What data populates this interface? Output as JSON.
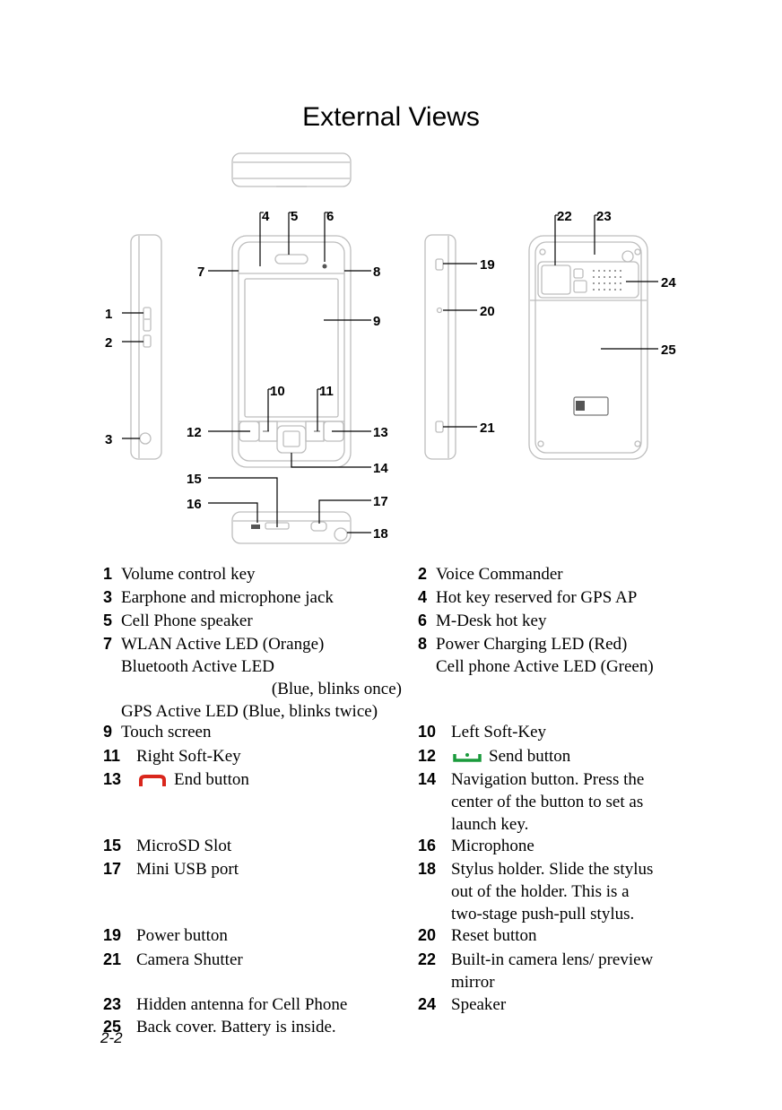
{
  "page": {
    "title": "External Views",
    "page_number": "2-2"
  },
  "colors": {
    "end_button_icon": "#d9261c",
    "send_button_icon": "#1a9a3c",
    "outline": "#bdbdbd"
  },
  "diagram": {
    "callouts": [
      "1",
      "2",
      "3",
      "4",
      "5",
      "6",
      "7",
      "8",
      "9",
      "10",
      "11",
      "12",
      "13",
      "14",
      "15",
      "16",
      "17",
      "18",
      "19",
      "20",
      "21",
      "22",
      "23",
      "24",
      "25"
    ]
  },
  "items": [
    {
      "num": "1",
      "lines": [
        "Volume control key"
      ]
    },
    {
      "num": "2",
      "lines": [
        "Voice Commander"
      ]
    },
    {
      "num": "3",
      "lines": [
        "Earphone and microphone jack"
      ]
    },
    {
      "num": "4",
      "lines": [
        "Hot key reserved for GPS AP"
      ]
    },
    {
      "num": "5",
      "lines": [
        "Cell Phone speaker"
      ]
    },
    {
      "num": "6",
      "lines": [
        "M-Desk hot key"
      ]
    },
    {
      "num": "7",
      "lines": [
        "WLAN Active LED (Orange)",
        "Bluetooth Active LED",
        "(Blue, blinks once)",
        "GPS Active LED (Blue, blinks twice)"
      ]
    },
    {
      "num": "8",
      "lines": [
        "Power Charging LED (Red)",
        "Cell phone Active LED (Green)"
      ]
    },
    {
      "num": "9",
      "lines": [
        "Touch screen"
      ]
    },
    {
      "num": "10",
      "lines": [
        "Left Soft-Key"
      ]
    },
    {
      "num": "11",
      "lines": [
        "Right Soft-Key"
      ]
    },
    {
      "num": "12",
      "icon": "send-button-icon",
      "lines": [
        "Send button"
      ]
    },
    {
      "num": "13",
      "icon": "end-button-icon",
      "lines": [
        "End button"
      ]
    },
    {
      "num": "14",
      "lines": [
        "Navigation button. Press the",
        "center of the button to set as",
        "launch key."
      ]
    },
    {
      "num": "15",
      "lines": [
        "MicroSD Slot"
      ]
    },
    {
      "num": "16",
      "lines": [
        "Microphone"
      ]
    },
    {
      "num": "17",
      "lines": [
        "Mini USB port"
      ]
    },
    {
      "num": "18",
      "lines": [
        "Stylus holder. Slide the stylus",
        "out of the holder. This is a",
        "two-stage push-pull stylus."
      ]
    },
    {
      "num": "19",
      "lines": [
        "Power button"
      ]
    },
    {
      "num": "20",
      "lines": [
        "Reset button"
      ]
    },
    {
      "num": "21",
      "lines": [
        "Camera Shutter"
      ]
    },
    {
      "num": "22",
      "lines": [
        "Built-in camera lens/ preview",
        "mirror"
      ]
    },
    {
      "num": "23",
      "lines": [
        "Hidden antenna for Cell Phone"
      ]
    },
    {
      "num": "24",
      "lines": [
        "Speaker"
      ]
    },
    {
      "num": "25",
      "lines": [
        "Back cover. Battery is inside."
      ]
    }
  ]
}
